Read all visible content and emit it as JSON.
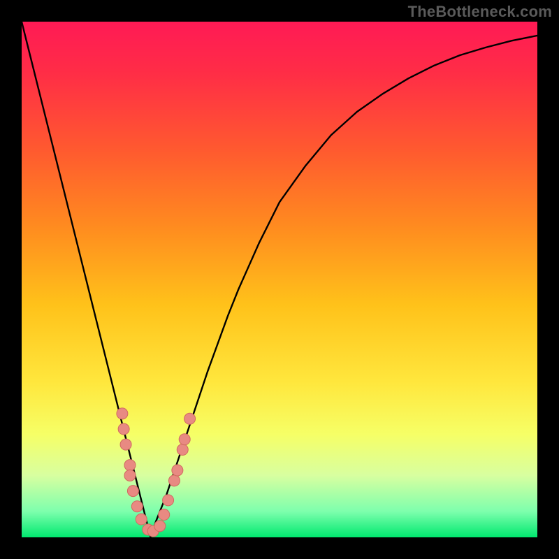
{
  "watermark": "TheBottleneck.com",
  "gradient_stops": [
    {
      "offset": 0.0,
      "color": "#ff1a55"
    },
    {
      "offset": 0.1,
      "color": "#ff2d46"
    },
    {
      "offset": 0.25,
      "color": "#ff5a2f"
    },
    {
      "offset": 0.4,
      "color": "#ff8c1f"
    },
    {
      "offset": 0.55,
      "color": "#ffc21a"
    },
    {
      "offset": 0.7,
      "color": "#ffe73d"
    },
    {
      "offset": 0.8,
      "color": "#f6ff66"
    },
    {
      "offset": 0.88,
      "color": "#d8ffa0"
    },
    {
      "offset": 0.95,
      "color": "#7dffad"
    },
    {
      "offset": 1.0,
      "color": "#00e86f"
    }
  ],
  "colors": {
    "curve": "#000000",
    "marker_fill": "#e88a82",
    "marker_stroke": "#d06a60"
  },
  "chart_data": {
    "type": "line",
    "title": "",
    "xlabel": "",
    "ylabel": "",
    "xlim": [
      0,
      100
    ],
    "ylim": [
      0,
      100
    ],
    "x": [
      0,
      2,
      4,
      6,
      8,
      10,
      12,
      14,
      16,
      18,
      20,
      22,
      24,
      25,
      26,
      28,
      30,
      32,
      34,
      36,
      38,
      40,
      42,
      44,
      46,
      48,
      50,
      55,
      60,
      65,
      70,
      75,
      80,
      85,
      90,
      95,
      100
    ],
    "y": [
      100,
      92,
      84,
      76,
      68,
      60,
      52,
      44,
      36,
      28,
      20,
      12,
      4,
      0,
      3,
      8,
      14,
      20,
      26,
      32,
      37.5,
      43,
      48,
      52.5,
      57,
      61,
      65,
      72,
      78,
      82.5,
      86,
      89,
      91.5,
      93.5,
      95,
      96.3,
      97.3
    ],
    "markers": [
      {
        "x": 19.5,
        "y": 24
      },
      {
        "x": 19.8,
        "y": 21
      },
      {
        "x": 20.2,
        "y": 18
      },
      {
        "x": 21.0,
        "y": 14
      },
      {
        "x": 21.0,
        "y": 12
      },
      {
        "x": 21.6,
        "y": 9
      },
      {
        "x": 22.4,
        "y": 6
      },
      {
        "x": 23.2,
        "y": 3.5
      },
      {
        "x": 24.5,
        "y": 1.5
      },
      {
        "x": 25.5,
        "y": 1.2
      },
      {
        "x": 26.8,
        "y": 2.2
      },
      {
        "x": 27.6,
        "y": 4.4
      },
      {
        "x": 28.4,
        "y": 7.2
      },
      {
        "x": 29.6,
        "y": 11
      },
      {
        "x": 30.2,
        "y": 13
      },
      {
        "x": 31.2,
        "y": 17
      },
      {
        "x": 31.6,
        "y": 19
      },
      {
        "x": 32.6,
        "y": 23
      }
    ]
  }
}
